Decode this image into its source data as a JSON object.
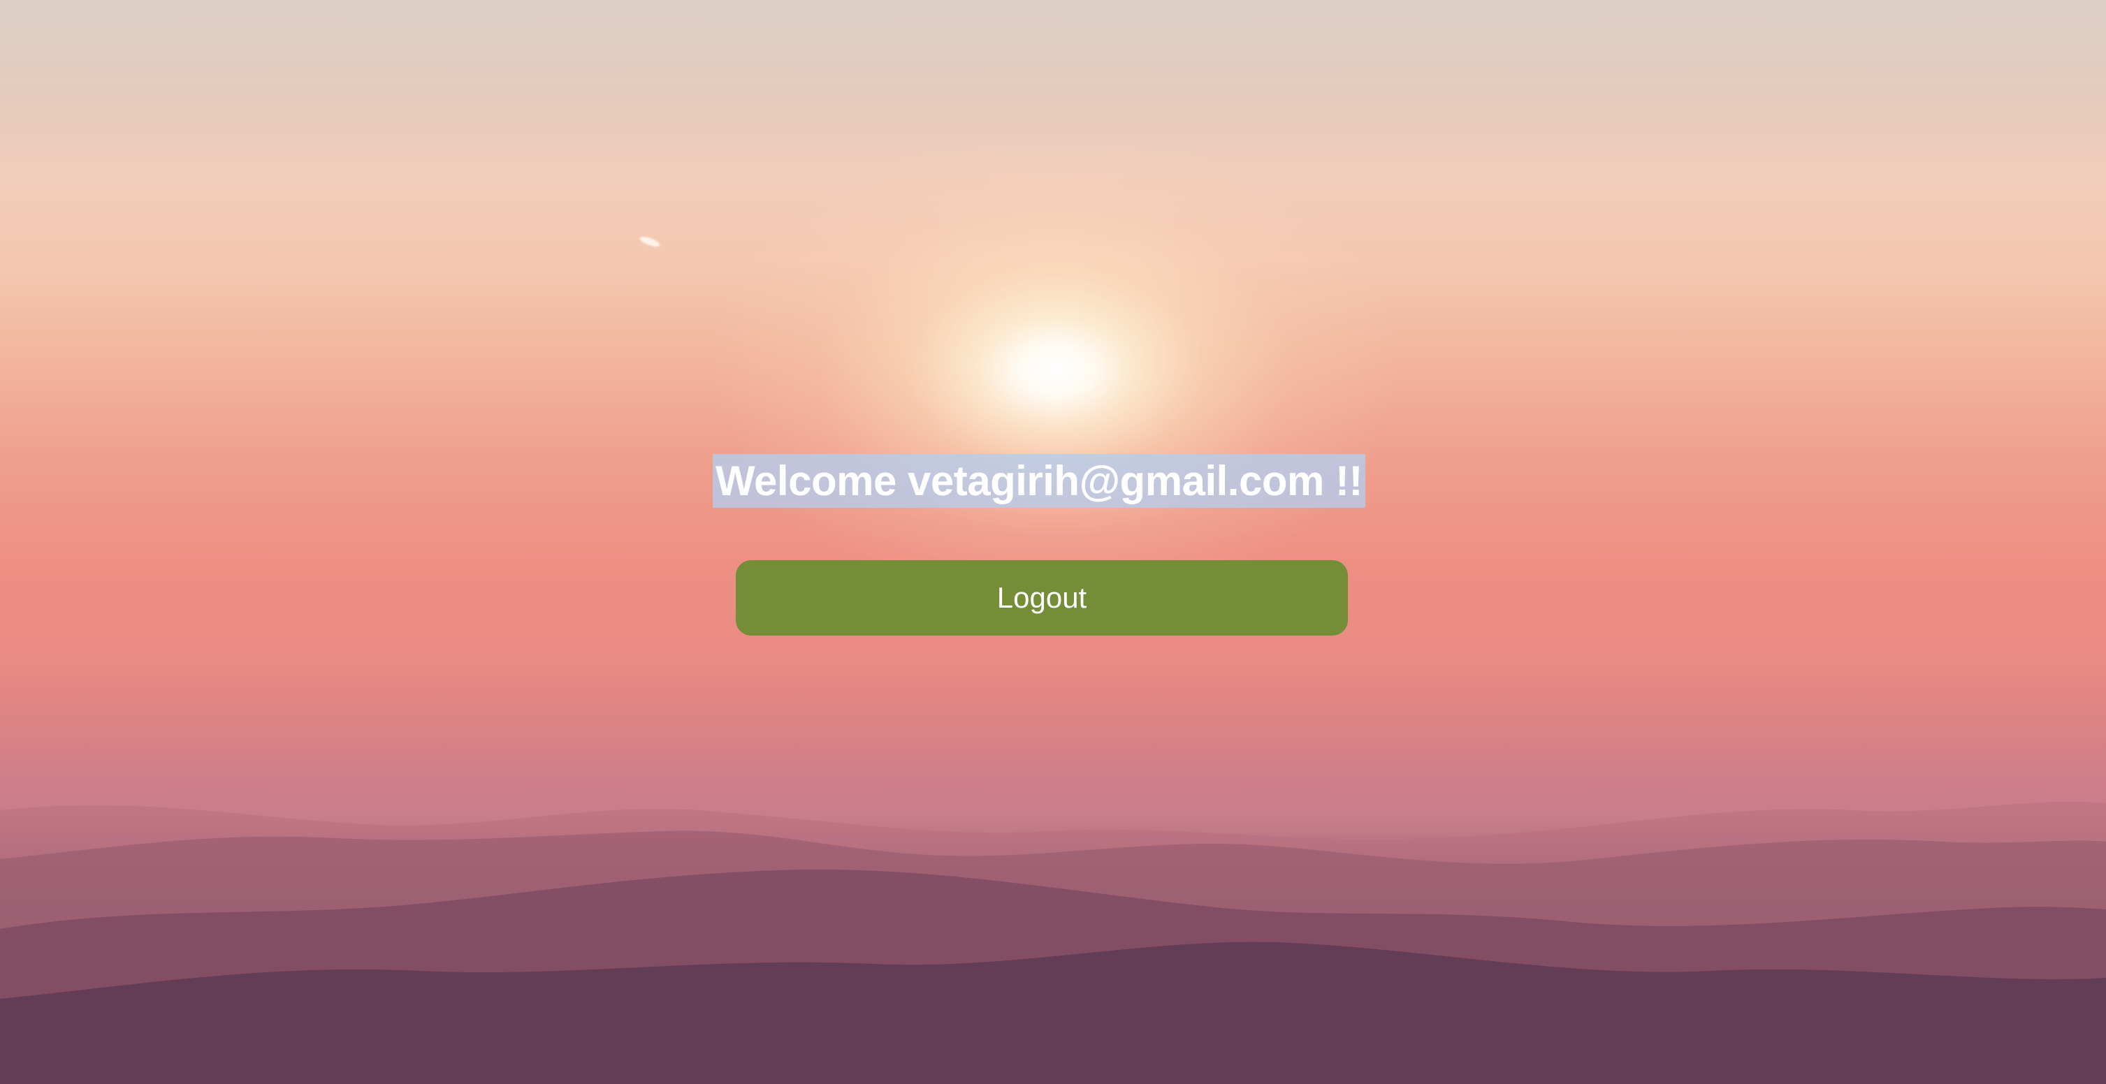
{
  "welcome": {
    "text": "Welcome vetagirih@gmail.com !!"
  },
  "actions": {
    "logout_label": "Logout"
  },
  "colors": {
    "logout_button_bg": "#768d38",
    "text": "#ffffff",
    "selection_highlight": "#b4cdf0"
  }
}
